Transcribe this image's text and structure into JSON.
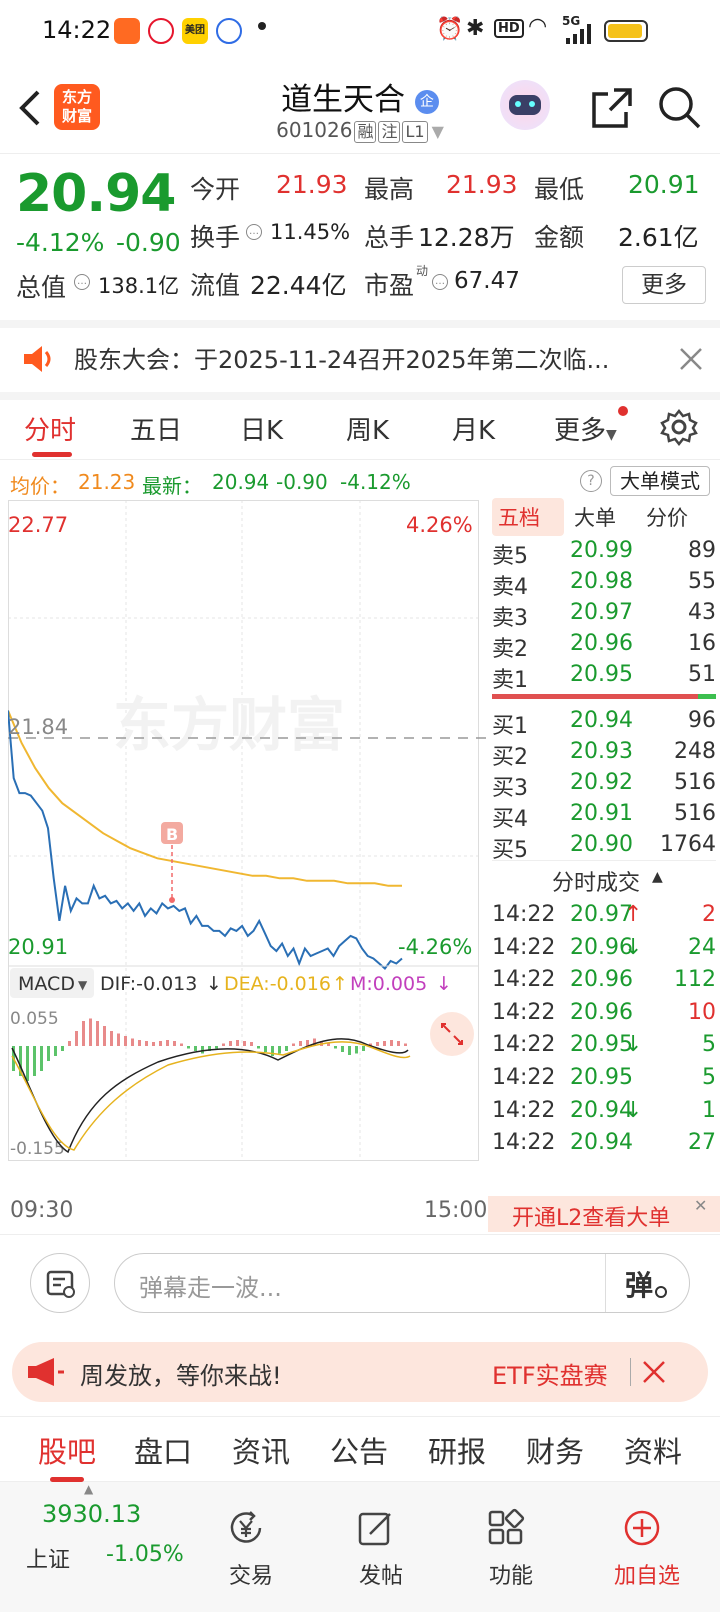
{
  "status_bar": {
    "time": "14:22",
    "network": "5G",
    "hd": "HD",
    "app_label": "美团"
  },
  "header": {
    "logo_text": "东方\n财富",
    "stock_name": "道生天合",
    "badge": "企",
    "code": "601026",
    "tags": [
      "融",
      "注",
      "L1"
    ]
  },
  "quote": {
    "price": "20.94",
    "change_pct": "-4.12%",
    "change": "-0.90",
    "open_label": "今开",
    "open": "21.93",
    "high_label": "最高",
    "high": "21.93",
    "low_label": "最低",
    "low": "20.91",
    "turnover_label": "换手",
    "turnover": "11.45%",
    "volume_label": "总手",
    "volume": "12.28万",
    "amount_label": "金额",
    "amount": "2.61亿",
    "mktcap_label": "总值",
    "mktcap": "138.1亿",
    "float_label": "流值",
    "float": "22.44亿",
    "pe_label": "市盈",
    "pe_sup": "动",
    "pe": "67.47",
    "more_label": "更多"
  },
  "notice": {
    "text": "股东大会：于2025-11-24召开2025年第二次临..."
  },
  "tabs": [
    "分时",
    "五日",
    "日K",
    "周K",
    "月K",
    "更多"
  ],
  "avg_row": {
    "avg_label": "均价：",
    "avg_value": "21.23",
    "latest_label": "最新：",
    "latest_value": "20.94",
    "change": "-0.90",
    "change_pct": "-4.12%",
    "mode_button": "大单模式"
  },
  "chart_data": {
    "type": "line",
    "title": "",
    "y_top_label": "22.77",
    "y_top_pct": "4.26%",
    "y_mid_label": "21.84",
    "y_bottom_label": "20.91",
    "y_bottom_pct": "-4.26%",
    "ylim": [
      20.91,
      22.77
    ],
    "watermark": "东方财富",
    "marker_label": "B",
    "price_series": [
      21.93,
      21.66,
      21.6,
      21.6,
      21.59,
      21.56,
      21.53,
      21.46,
      21.26,
      21.09,
      21.23,
      21.13,
      21.18,
      21.16,
      21.16,
      21.23,
      21.18,
      21.19,
      21.16,
      21.17,
      21.14,
      21.16,
      21.13,
      21.16,
      21.11,
      21.14,
      21.12,
      21.16,
      21.14,
      21.15,
      21.13,
      21.14,
      21.08,
      21.11,
      21.07,
      21.07,
      21.05,
      21.05,
      21.03,
      21.06,
      21.05,
      21.07,
      21.03,
      21.05,
      21.09,
      21.04,
      20.99,
      20.97,
      21.0,
      20.95,
      20.98,
      20.92,
      20.98,
      20.95,
      20.96,
      20.97,
      20.98,
      20.95,
      20.99,
      21.01,
      21.03,
      21.02,
      20.98,
      20.95,
      20.94,
      20.92,
      20.9,
      20.93,
      20.92,
      20.94
    ],
    "avg_series": [
      21.93,
      21.8,
      21.7,
      21.62,
      21.56,
      21.52,
      21.48,
      21.44,
      21.41,
      21.38,
      21.36,
      21.34,
      21.33,
      21.32,
      21.31,
      21.3,
      21.29,
      21.28,
      21.27,
      21.27,
      21.26,
      21.26,
      21.25,
      21.25,
      21.25,
      21.24,
      21.24,
      21.24,
      21.23,
      21.23
    ],
    "macd": {
      "label": "MACD",
      "dif_label": "DIF:",
      "dif": "-0.013",
      "dea_label": "DEA:",
      "dea": "-0.016",
      "m_label": "M:",
      "m": "0.005",
      "ymax": "0.055",
      "ymin": "-0.155",
      "histogram": [
        -0.05,
        -0.06,
        -0.07,
        -0.06,
        -0.05,
        -0.03,
        -0.02,
        -0.01,
        0.01,
        0.03,
        0.05,
        0.055,
        0.05,
        0.04,
        0.03,
        0.025,
        0.02,
        0.015,
        0.012,
        0.01,
        0.008,
        0.01,
        0.012,
        0.01,
        0.005,
        -0.005,
        -0.01,
        -0.015,
        -0.01,
        -0.005,
        0.005,
        0.01,
        0.012,
        0.01,
        0.008,
        -0.005,
        -0.012,
        -0.02,
        -0.015,
        -0.01,
        0.005,
        0.01,
        0.012,
        0.015,
        0.01,
        0.005,
        -0.005,
        -0.012,
        -0.018,
        -0.015,
        -0.01,
        0.005,
        0.008,
        0.01,
        0.012,
        0.01,
        0.005
      ]
    },
    "x_start": "09:30",
    "x_end": "15:00"
  },
  "order_book": {
    "tabs": [
      "五档",
      "大单",
      "分价"
    ],
    "asks": [
      {
        "label": "卖5",
        "price": "20.99",
        "vol": "89"
      },
      {
        "label": "卖4",
        "price": "20.98",
        "vol": "55"
      },
      {
        "label": "卖3",
        "price": "20.97",
        "vol": "43"
      },
      {
        "label": "卖2",
        "price": "20.96",
        "vol": "16"
      },
      {
        "label": "卖1",
        "price": "20.95",
        "vol": "51"
      }
    ],
    "bids": [
      {
        "label": "买1",
        "price": "20.94",
        "vol": "96"
      },
      {
        "label": "买2",
        "price": "20.93",
        "vol": "248"
      },
      {
        "label": "买3",
        "price": "20.92",
        "vol": "516"
      },
      {
        "label": "买4",
        "price": "20.91",
        "vol": "516"
      },
      {
        "label": "买5",
        "price": "20.90",
        "vol": "1764"
      }
    ],
    "ticks_title": "分时成交",
    "ticks": [
      {
        "time": "14:22",
        "price": "20.97",
        "arrow": "↑",
        "vol": "2",
        "vol_color": "#e0312f"
      },
      {
        "time": "14:22",
        "price": "20.96",
        "arrow": "↓",
        "vol": "24",
        "vol_color": "#1a9a2e"
      },
      {
        "time": "14:22",
        "price": "20.96",
        "arrow": "",
        "vol": "112",
        "vol_color": "#1a9a2e"
      },
      {
        "time": "14:22",
        "price": "20.96",
        "arrow": "",
        "vol": "10",
        "vol_color": "#e0312f"
      },
      {
        "time": "14:22",
        "price": "20.95",
        "arrow": "↓",
        "vol": "5",
        "vol_color": "#1a9a2e"
      },
      {
        "time": "14:22",
        "price": "20.95",
        "arrow": "",
        "vol": "5",
        "vol_color": "#1a9a2e"
      },
      {
        "time": "14:22",
        "price": "20.94",
        "arrow": "↓",
        "vol": "1",
        "vol_color": "#1a9a2e"
      },
      {
        "time": "14:22",
        "price": "20.94",
        "arrow": "",
        "vol": "27",
        "vol_color": "#1a9a2e"
      }
    ],
    "l2_promo": "开通L2查看大单"
  },
  "danmu": {
    "placeholder": "弹幕走一波...",
    "send_label": "弹"
  },
  "ad": {
    "left_text": "周发放，等你来战!",
    "right_text": "ETF实盘赛"
  },
  "bottom_tabs": [
    "股吧",
    "盘口",
    "资讯",
    "公告",
    "研报",
    "财务",
    "资料"
  ],
  "footer": {
    "index_value": "3930.13",
    "index_name": "上证",
    "index_change": "-1.05%",
    "items": [
      {
        "label": "交易",
        "icon": "yen-exchange-icon"
      },
      {
        "label": "发帖",
        "icon": "edit-icon"
      },
      {
        "label": "功能",
        "icon": "grid-apps-icon"
      },
      {
        "label": "加自选",
        "icon": "plus-circle-icon"
      }
    ]
  },
  "colors": {
    "up": "#e0312f",
    "down": "#1a9a2e",
    "avg_line": "#f0b731",
    "price_line": "#2a6fb5",
    "accent": "#ff5a1f"
  }
}
